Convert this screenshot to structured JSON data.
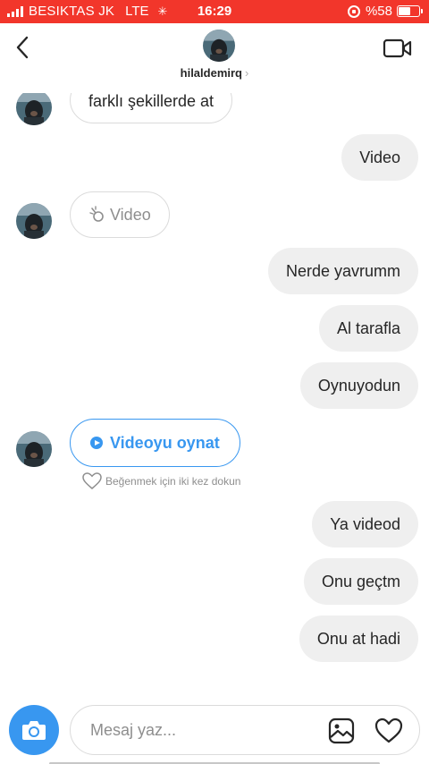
{
  "status_bar": {
    "carrier": "BESIKTAS JK",
    "network": "LTE",
    "activity_icon": "spinner-icon",
    "time": "16:29",
    "battery_percent": "%58",
    "battery_level": 0.58,
    "background_color": "#f2362b"
  },
  "header": {
    "username": "hilaldemirq",
    "chevron": "›",
    "back_icon": "chevron-left-icon",
    "video_call_icon": "video-camera-icon"
  },
  "messages": [
    {
      "direction": "in",
      "text": "farklı şekillerde at"
    },
    {
      "direction": "out",
      "text": "Video"
    },
    {
      "direction": "in",
      "text": "Video",
      "kind": "video-unavailable"
    },
    {
      "direction": "out",
      "text": "Nerde yavrumm"
    },
    {
      "direction": "out",
      "text": "Al tarafla"
    },
    {
      "direction": "out",
      "text": "Oynuyodun"
    },
    {
      "direction": "in",
      "text": "Videoyu oynat",
      "kind": "video-play"
    },
    {
      "direction": "out",
      "text": "Ya videod"
    },
    {
      "direction": "out",
      "text": "Onu geçtm"
    },
    {
      "direction": "out",
      "text": "Onu at hadi"
    }
  ],
  "like_hint": "Beğenmek için iki kez dokun",
  "composer": {
    "placeholder": "Mesaj yaz...",
    "camera_icon": "camera-icon",
    "gallery_icon": "image-gallery-icon",
    "like_icon": "heart-icon"
  },
  "colors": {
    "accent": "#3897f0",
    "outgoing_bubble": "#efefef",
    "incoming_border": "#dbdbdb",
    "muted_text": "#8e8e8e"
  }
}
